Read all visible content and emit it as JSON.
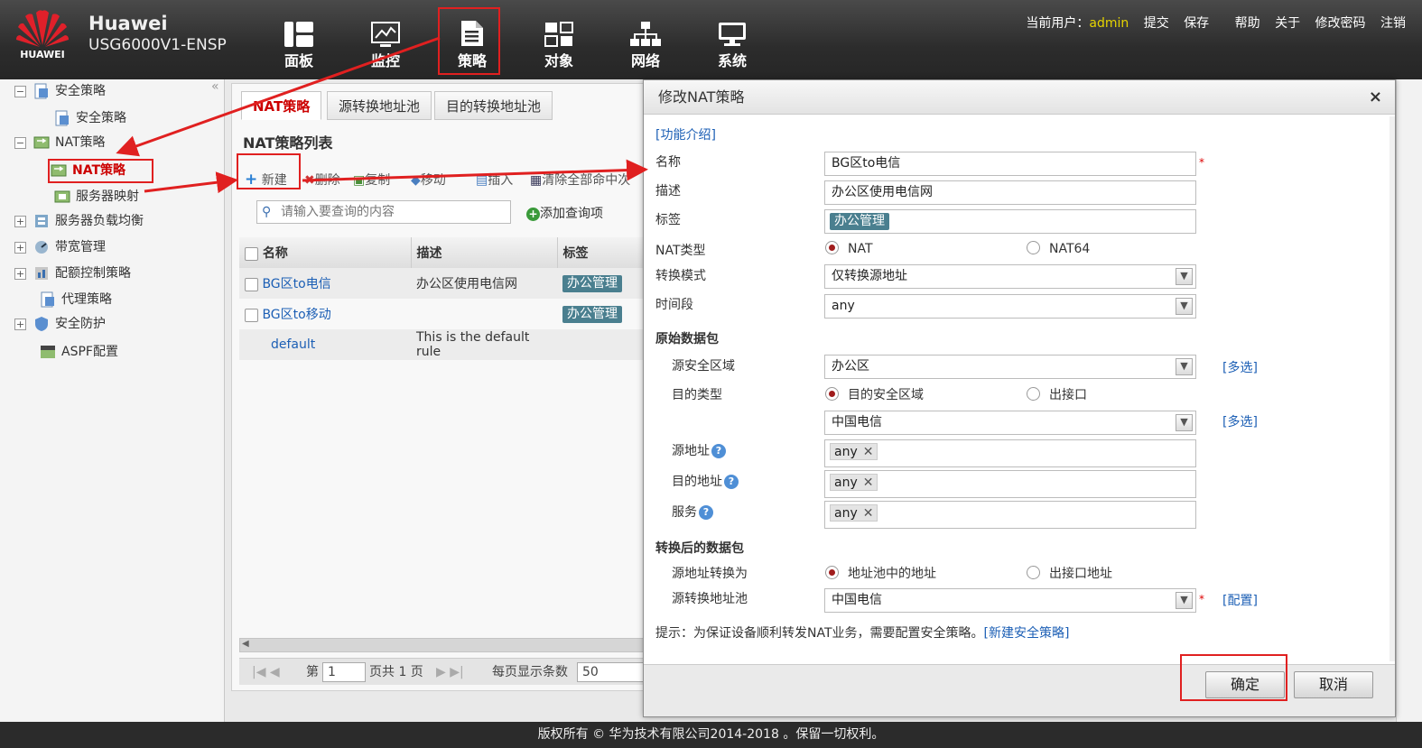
{
  "header": {
    "logo_text": "HUAWEI",
    "brand_name": "Huawei",
    "device_model": "USG6000V1-ENSP",
    "nav": [
      {
        "label": "面板",
        "icon": "dashboard-icon"
      },
      {
        "label": "监控",
        "icon": "monitor-icon"
      },
      {
        "label": "策略",
        "icon": "policy-document-icon"
      },
      {
        "label": "对象",
        "icon": "object-icon"
      },
      {
        "label": "网络",
        "icon": "network-icon"
      },
      {
        "label": "系统",
        "icon": "system-icon"
      }
    ],
    "user_label": "当前用户：",
    "username": "admin",
    "actions": [
      "提交",
      "保存",
      "帮助",
      "关于",
      "修改密码",
      "注销"
    ]
  },
  "sidebar": {
    "collapse_glyph": "«",
    "items": [
      {
        "label": "安全策略",
        "toggle": "−"
      },
      {
        "label": "安全策略"
      },
      {
        "label": "NAT策略",
        "toggle": "−"
      },
      {
        "label": "NAT策略"
      },
      {
        "label": "服务器映射"
      },
      {
        "label": "服务器负载均衡",
        "toggle": "+"
      },
      {
        "label": "带宽管理",
        "toggle": "+"
      },
      {
        "label": "配额控制策略",
        "toggle": "+"
      },
      {
        "label": "代理策略"
      },
      {
        "label": "安全防护",
        "toggle": "+"
      },
      {
        "label": "ASPF配置"
      }
    ]
  },
  "main": {
    "tabs": [
      "NAT策略",
      "源转换地址池",
      "目的转换地址池"
    ],
    "list_title": "NAT策略列表",
    "toolbar": [
      "新建",
      "删除",
      "复制",
      "移动",
      "插入",
      "清除全部命中次"
    ],
    "search_placeholder": "请输入要查询的内容",
    "add_query": "添加查询项",
    "columns": [
      "名称",
      "描述",
      "标签"
    ],
    "rows": [
      {
        "name": "BG区to电信",
        "desc": "办公区使用电信网",
        "tag": "办公管理"
      },
      {
        "name": "BG区to移动",
        "desc": "",
        "tag": "办公管理"
      },
      {
        "name": "default",
        "desc": "This is the default rule",
        "tag": ""
      }
    ],
    "pager": {
      "prefix": "第",
      "page": "1",
      "suffix": "页共 1 页",
      "per_page_label": "每页显示条数",
      "per_page": "50"
    }
  },
  "dialog": {
    "title": "修改NAT策略",
    "close": "×",
    "intro_link": "[功能介绍]",
    "name_label": "名称",
    "name_value": "BG区to电信",
    "desc_label": "描述",
    "desc_value": "办公区使用电信网",
    "tag_label": "标签",
    "tag_value": "办公管理",
    "nat_type_label": "NAT类型",
    "nat_type_options": [
      "NAT",
      "NAT64"
    ],
    "mode_label": "转换模式",
    "mode_value": "仅转换源地址",
    "time_label": "时间段",
    "time_value": "any",
    "orig_section": "原始数据包",
    "src_zone_label": "源安全区域",
    "src_zone_value": "办公区",
    "multi_link": "[多选]",
    "dst_type_label": "目的类型",
    "dst_type_options": [
      "目的安全区域",
      "出接口"
    ],
    "dst_zone_value": "中国电信",
    "src_addr_label": "源地址",
    "dst_addr_label": "目的地址",
    "service_label": "服务",
    "any_chip": "any",
    "chip_remove": "✕",
    "help_glyph": "?",
    "trans_section": "转换后的数据包",
    "src_trans_label": "源地址转换为",
    "src_trans_options": [
      "地址池中的地址",
      "出接口地址"
    ],
    "pool_label": "源转换地址池",
    "pool_value": "中国电信",
    "config_link": "[配置]",
    "hint": "提示：为保证设备顺利转发NAT业务，需要配置安全策略。",
    "hint_link": "[新建安全策略]",
    "ok": "确定",
    "cancel": "取消",
    "required_mark": "*"
  },
  "footer": {
    "copyright": "版权所有 © 华为技术有限公司2014-2018 。保留一切权利。"
  },
  "colors": {
    "annotation_red": "#e02020",
    "link_blue": "#1c5fb5",
    "tag_bg": "#4a7f8f",
    "username_yellow": "#e6d400"
  }
}
